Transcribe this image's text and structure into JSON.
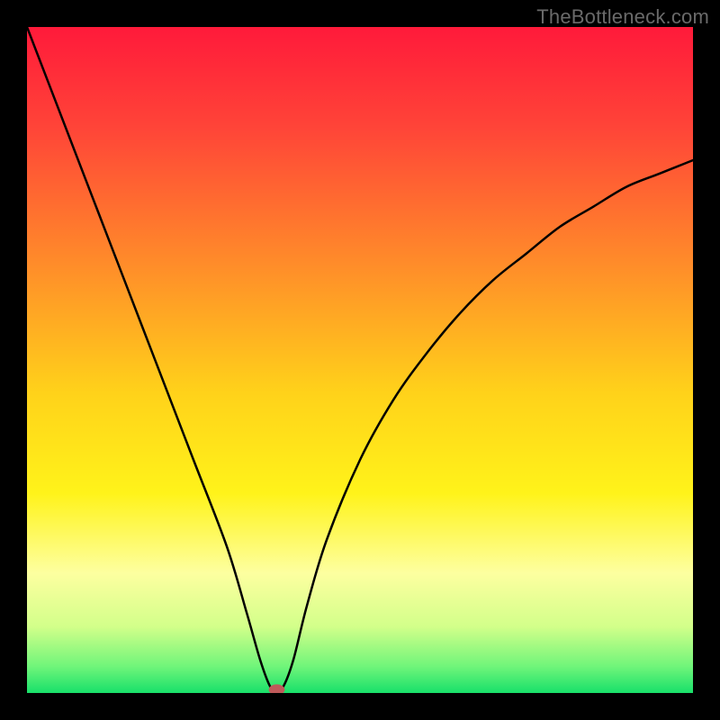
{
  "watermark": "TheBottleneck.com",
  "chart_data": {
    "type": "line",
    "title": "",
    "xlabel": "",
    "ylabel": "",
    "xlim": [
      0,
      100
    ],
    "ylim": [
      0,
      100
    ],
    "background_gradient": {
      "stops": [
        {
          "offset": 0.0,
          "color": "#ff1a3a"
        },
        {
          "offset": 0.15,
          "color": "#ff4438"
        },
        {
          "offset": 0.35,
          "color": "#ff8a2a"
        },
        {
          "offset": 0.55,
          "color": "#ffd21a"
        },
        {
          "offset": 0.7,
          "color": "#fff31a"
        },
        {
          "offset": 0.82,
          "color": "#fdffa0"
        },
        {
          "offset": 0.9,
          "color": "#d3ff8a"
        },
        {
          "offset": 0.96,
          "color": "#70f57a"
        },
        {
          "offset": 1.0,
          "color": "#18e06a"
        }
      ]
    },
    "series": [
      {
        "name": "bottleneck-curve",
        "points": [
          {
            "x": 0,
            "y": 100
          },
          {
            "x": 5,
            "y": 87
          },
          {
            "x": 10,
            "y": 74
          },
          {
            "x": 15,
            "y": 61
          },
          {
            "x": 20,
            "y": 48
          },
          {
            "x": 25,
            "y": 35
          },
          {
            "x": 30,
            "y": 22
          },
          {
            "x": 33,
            "y": 12
          },
          {
            "x": 35,
            "y": 5
          },
          {
            "x": 36.5,
            "y": 1
          },
          {
            "x": 37.5,
            "y": 0.5
          },
          {
            "x": 38.5,
            "y": 1
          },
          {
            "x": 40,
            "y": 5
          },
          {
            "x": 42,
            "y": 13
          },
          {
            "x": 45,
            "y": 23
          },
          {
            "x": 50,
            "y": 35
          },
          {
            "x": 55,
            "y": 44
          },
          {
            "x": 60,
            "y": 51
          },
          {
            "x": 65,
            "y": 57
          },
          {
            "x": 70,
            "y": 62
          },
          {
            "x": 75,
            "y": 66
          },
          {
            "x": 80,
            "y": 70
          },
          {
            "x": 85,
            "y": 73
          },
          {
            "x": 90,
            "y": 76
          },
          {
            "x": 95,
            "y": 78
          },
          {
            "x": 100,
            "y": 80
          }
        ]
      }
    ],
    "marker": {
      "x": 37.5,
      "y": 0.5,
      "rx": 1.2,
      "ry": 0.8,
      "color": "#c05a5a"
    }
  }
}
